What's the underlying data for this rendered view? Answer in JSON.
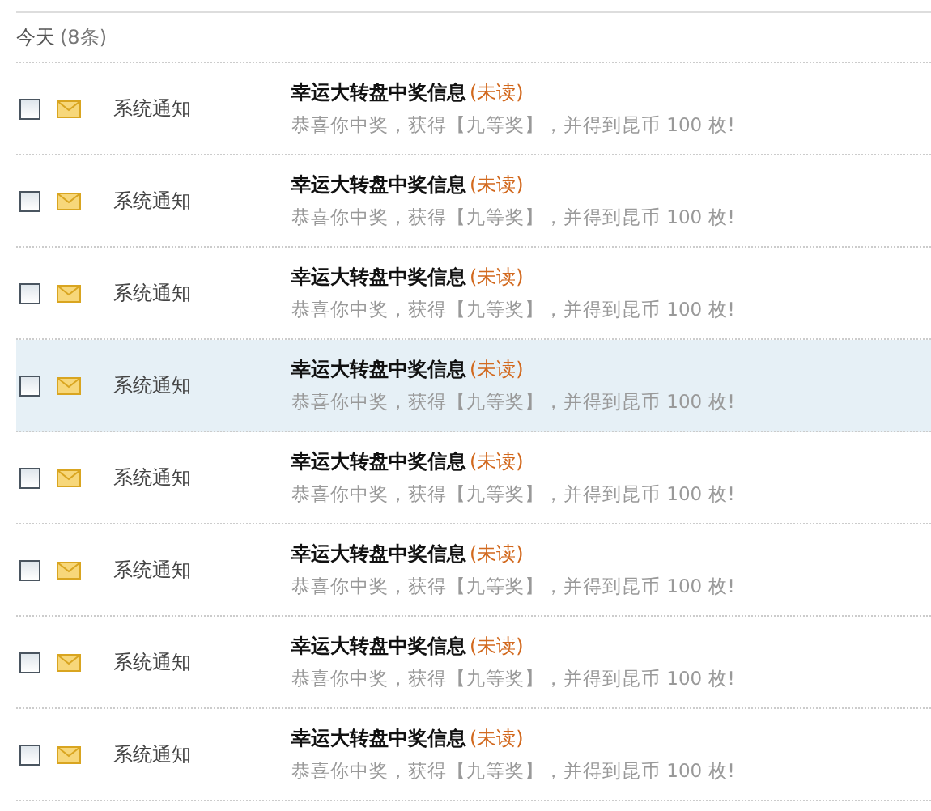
{
  "group": {
    "label": "今天",
    "count": "(8条)"
  },
  "messages": [
    {
      "sender": "系统通知",
      "title": "幸运大转盘中奖信息",
      "status": "(未读)",
      "body": "恭喜你中奖，获得【九等奖】，并得到昆币 100 枚!",
      "checked": false,
      "selected": false
    },
    {
      "sender": "系统通知",
      "title": "幸运大转盘中奖信息",
      "status": "(未读)",
      "body": "恭喜你中奖，获得【九等奖】，并得到昆币 100 枚!",
      "checked": false,
      "selected": false
    },
    {
      "sender": "系统通知",
      "title": "幸运大转盘中奖信息",
      "status": "(未读)",
      "body": "恭喜你中奖，获得【九等奖】，并得到昆币 100 枚!",
      "checked": false,
      "selected": false
    },
    {
      "sender": "系统通知",
      "title": "幸运大转盘中奖信息",
      "status": "(未读)",
      "body": "恭喜你中奖，获得【九等奖】，并得到昆币 100 枚!",
      "checked": false,
      "selected": true
    },
    {
      "sender": "系统通知",
      "title": "幸运大转盘中奖信息",
      "status": "(未读)",
      "body": "恭喜你中奖，获得【九等奖】，并得到昆币 100 枚!",
      "checked": false,
      "selected": false
    },
    {
      "sender": "系统通知",
      "title": "幸运大转盘中奖信息",
      "status": "(未读)",
      "body": "恭喜你中奖，获得【九等奖】，并得到昆币 100 枚!",
      "checked": false,
      "selected": false
    },
    {
      "sender": "系统通知",
      "title": "幸运大转盘中奖信息",
      "status": "(未读)",
      "body": "恭喜你中奖，获得【九等奖】，并得到昆币 100 枚!",
      "checked": false,
      "selected": false
    },
    {
      "sender": "系统通知",
      "title": "幸运大转盘中奖信息",
      "status": "(未读)",
      "body": "恭喜你中奖，获得【九等奖】，并得到昆币 100 枚!",
      "checked": false,
      "selected": false
    }
  ]
}
